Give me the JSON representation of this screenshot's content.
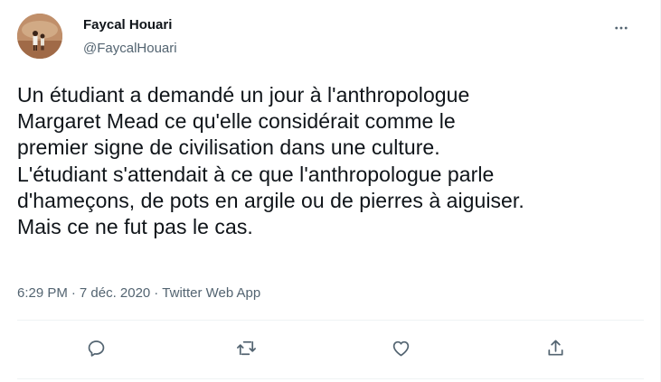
{
  "author": {
    "name": "Faycal Houari",
    "handle": "@FaycalHouari"
  },
  "tweet": {
    "text": "Un étudiant a demandé un jour à l'anthropologue\nMargaret Mead ce qu'elle considérait comme le\npremier signe de civilisation dans une culture.\nL'étudiant s'attendait à ce que l'anthropologue parle\nd'hameçons, de pots en argile ou de pierres à aiguiser.\nMais ce ne fut pas le cas."
  },
  "meta": {
    "time": "6:29 PM",
    "separator": "·",
    "date": "7 déc. 2020",
    "source": "Twitter Web App"
  },
  "icons": {
    "more": "more-horizontal-icon",
    "reply": "reply-icon",
    "retweet": "retweet-icon",
    "like": "heart-icon",
    "share": "share-icon"
  },
  "colors": {
    "text": "#0f1419",
    "secondary": "#536471",
    "divider": "#eff3f4"
  }
}
